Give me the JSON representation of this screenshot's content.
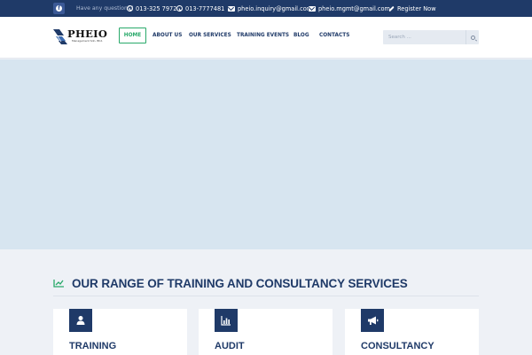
{
  "topbar": {
    "question": "Have any questions?",
    "phone_1": "013-325 7972",
    "phone_2": "013-7777481",
    "email_1": "pheio.inquiry@gmail.com",
    "email_2": "pheio.mgmt@gmail.com",
    "register": "Register Now",
    "background": "#1f3a68"
  },
  "logo": {
    "name": "PHEIO",
    "subtitle": "Management Sdn. Bhd."
  },
  "nav": {
    "home": "HOME",
    "about": "ABOUT US",
    "services": "OUR SERVICES",
    "training_events": "TRAINING EVENTS",
    "blog": "BLOG",
    "contacts": "CONTACTS",
    "active": "home",
    "active_color": "#29a96a"
  },
  "search": {
    "placeholder": "Search ..."
  },
  "services": {
    "title": "OUR RANGE OF TRAINING AND CONSULTANCY SERVICES",
    "accent": "#29a96a",
    "cards": [
      {
        "title": "TRAINING",
        "icon": "user-icon"
      },
      {
        "title": "AUDIT",
        "icon": "bar-chart-icon"
      },
      {
        "title": "CONSULTANCY",
        "icon": "megaphone-icon"
      }
    ]
  },
  "colors": {
    "brand_navy": "#1f3a68",
    "hero_bg": "#d7e5f0",
    "page_bg": "#eef1f6"
  }
}
